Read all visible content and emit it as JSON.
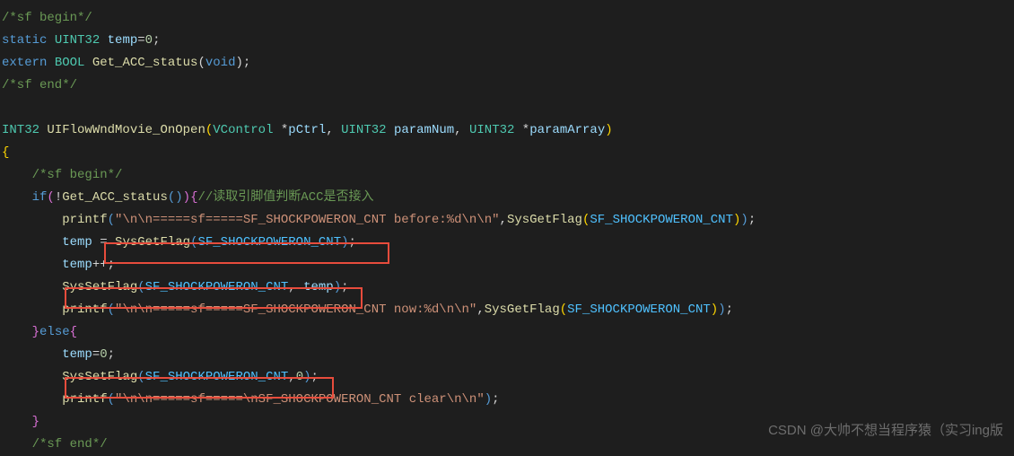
{
  "lines": {
    "l1": "/*sf begin*/",
    "l2_static": "static",
    "l2_type": " UINT32",
    "l2_var": " temp",
    "l2_rest": "=",
    "l2_num": "0",
    "l2_semi": ";",
    "l3_extern": "extern",
    "l3_type": " BOOL",
    "l3_func": " Get_ACC_status",
    "l3_paren_o": "(",
    "l3_void": "void",
    "l3_paren_c": ")",
    "l3_semi": ";",
    "l4": "/*sf end*/",
    "l6_type1": "INT32",
    "l6_func": " UIFlowWndMovie_OnOpen",
    "l6_po": "(",
    "l6_type2": "VControl",
    "l6_star": " *",
    "l6_p1": "pCtrl",
    "l6_c1": ", ",
    "l6_type3": "UINT32",
    "l6_sp": " ",
    "l6_p2": "paramNum",
    "l6_c2": ", ",
    "l6_type4": "UINT32",
    "l6_star2": " *",
    "l6_p3": "paramArray",
    "l6_pc": ")",
    "l7": "{",
    "l8": "    /*sf begin*/",
    "l9_indent": "    ",
    "l9_if": "if",
    "l9_po": "(",
    "l9_not": "!",
    "l9_func": "Get_ACC_status",
    "l9_pp": "()",
    "l9_pc": ")",
    "l9_brace": "{",
    "l9_comment": "//读取引脚值判断ACC是否接入",
    "l10_indent": "        ",
    "l10_func": "printf",
    "l10_po": "(",
    "l10_str": "\"\\n\\n=====sf=====SF_SHOCKPOWERON_CNT before:%d\\n\\n\"",
    "l10_c": ",",
    "l10_func2": "SysGetFlag",
    "l10_po2": "(",
    "l10_const": "SF_SHOCKPOWERON_CNT",
    "l10_pc2": ")",
    "l10_pc": ")",
    "l10_semi": ";",
    "l11_indent": "        ",
    "l11_var": "temp",
    "l11_eq": " = ",
    "l11_func": "SysGetFlag",
    "l11_po": "(",
    "l11_const": "SF_SHOCKPOWERON_CNT",
    "l11_pc": ")",
    "l11_semi": ";",
    "l12_indent": "        ",
    "l12_var": "temp",
    "l12_op": "++",
    "l12_semi": ";",
    "l13_indent": "        ",
    "l13_func": "SysSetFlag",
    "l13_po": "(",
    "l13_const": "SF_SHOCKPOWERON_CNT",
    "l13_c": ", ",
    "l13_var": "temp",
    "l13_pc": ")",
    "l13_semi": ";",
    "l14_indent": "        ",
    "l14_func": "printf",
    "l14_po": "(",
    "l14_str": "\"\\n\\n=====sf=====SF_SHOCKPOWERON_CNT now:%d\\n\\n\"",
    "l14_c": ",",
    "l14_func2": "SysGetFlag",
    "l14_po2": "(",
    "l14_const": "SF_SHOCKPOWERON_CNT",
    "l14_pc2": ")",
    "l14_pc": ")",
    "l14_semi": ";",
    "l15_indent": "    ",
    "l15_brace_c": "}",
    "l15_else": "else",
    "l15_brace_o": "{",
    "l16_indent": "        ",
    "l16_var": "temp",
    "l16_eq": "=",
    "l16_num": "0",
    "l16_semi": ";",
    "l17_indent": "        ",
    "l17_func": "SysSetFlag",
    "l17_po": "(",
    "l17_const": "SF_SHOCKPOWERON_CNT",
    "l17_c": ",",
    "l17_num": "0",
    "l17_pc": ")",
    "l17_semi": ";",
    "l18_indent": "        ",
    "l18_func": "printf",
    "l18_po": "(",
    "l18_str": "\"\\n\\n=====sf=====\\nSF_SHOCKPOWERON_CNT clear\\n\\n\"",
    "l18_pc": ")",
    "l18_semi": ";",
    "l19_indent": "    ",
    "l19_brace": "}",
    "l20": "    /*sf end*/"
  },
  "watermark": "CSDN @大帅不想当程序猿（实习ing版"
}
